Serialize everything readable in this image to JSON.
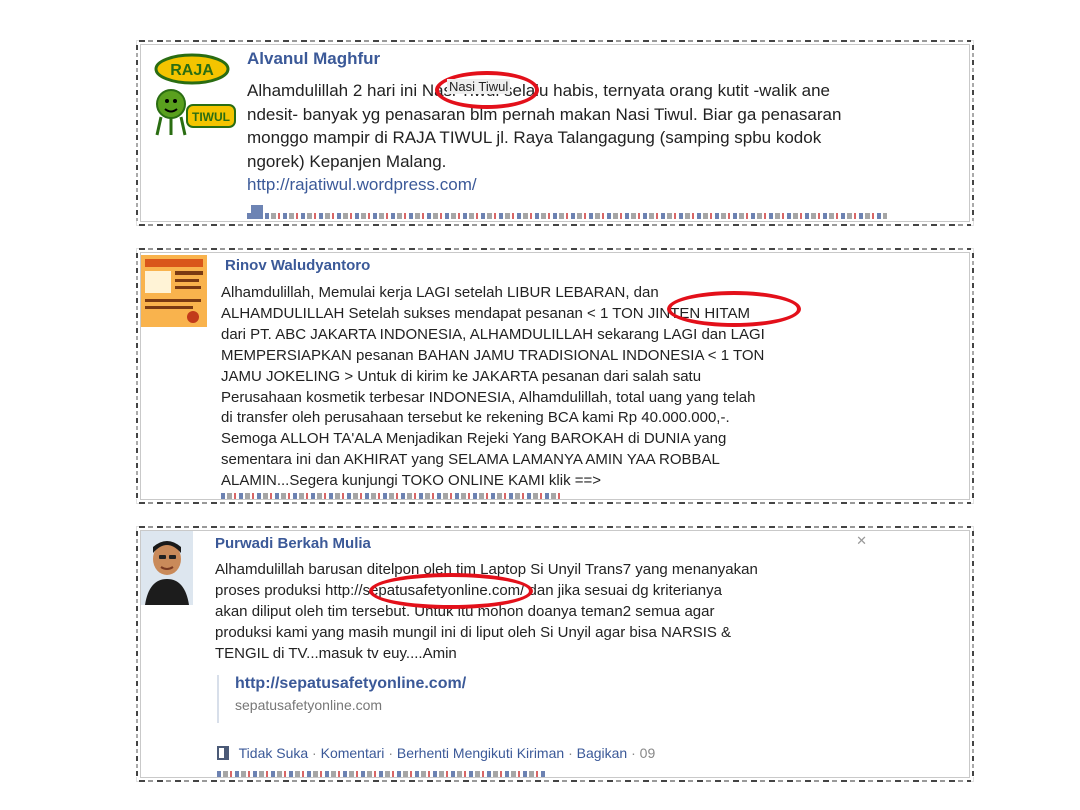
{
  "posts": [
    {
      "author": "Alvanul Maghfur",
      "avatar_text": [
        "RAJA",
        "TIWUL"
      ],
      "highlight_text": "Nasi Tiwul",
      "lines": [
        "Alhamdulillah 2 hari ini Nasi Tiwul selalu habis, ternyata orang kutit -walik ane",
        "ndesit- banyak yg penasaran blm pernah makan Nasi Tiwul. Biar ga penasaran",
        "monggo mampir di RAJA TIWUL jl. Raya Talangagung (samping spbu kodok",
        "ngorek) Kepanjen Malang."
      ],
      "link": "http://rajatiwul.wordpress.com/"
    },
    {
      "author": "Rinov Waludyantoro",
      "highlight_text": "JINTEN HITAM",
      "lines": [
        "Alhamdulillah, Memulai kerja LAGI setelah LIBUR LEBARAN, dan",
        "ALHAMDULILLAH Setelah sukses mendapat pesanan < 1 TON JINTEN HITAM",
        "dari PT. ABC JAKARTA INDONESIA, ALHAMDULILLAH sekarang LAGI dan LAGI",
        "MEMPERSIAPKAN pesanan BAHAN JAMU TRADISIONAL INDONESIA < 1 TON",
        "JAMU JOKELING > Untuk di kirim ke JAKARTA pesanan dari salah satu",
        "Perusahaan kosmetik terbesar INDONESIA, Alhamdulillah, total uang yang telah",
        "di transfer oleh perusahaan tersebut ke rekening BCA kami Rp 40.000.000,-.",
        "Semoga ALLOH TA'ALA Menjadikan Rejeki Yang BAROKAH di DUNIA yang",
        "sementara ini dan AKHIRAT yang SELAMA LAMANYA AMIN YAA ROBBAL",
        "ALAMIN...Segera kunjungi TOKO ONLINE KAMI klik ==>"
      ]
    },
    {
      "author": "Purwadi Berkah Mulia",
      "highlight_text": "sepatusafetyonline",
      "lines": [
        "Alhamdulillah barusan ditelpon oleh tim Laptop Si Unyil Trans7 yang menanyakan",
        "proses produksi http://sepatusafetyonline.com/ dan jika sesuai dg kriterianya",
        "akan diliput oleh tim tersebut. Untuk itu mohon doanya teman2 semua agar",
        "produksi kami yang masih mungil ini di liput oleh Si Unyil agar bisa NARSIS &",
        "TENGIL di TV...masuk tv euy....Amin"
      ],
      "attachment": {
        "title": "http://sepatusafetyonline.com/",
        "domain": "sepatusafetyonline.com"
      },
      "actions": {
        "unlike": "Tidak Suka",
        "comment": "Komentari",
        "unfollow": "Berhenti Mengikuti Kiriman",
        "share": "Bagikan",
        "time": "09",
        "separator": "·"
      }
    }
  ],
  "colors": {
    "link": "#3b5998",
    "highlight_oval": "#e3101a",
    "text": "#222222"
  }
}
